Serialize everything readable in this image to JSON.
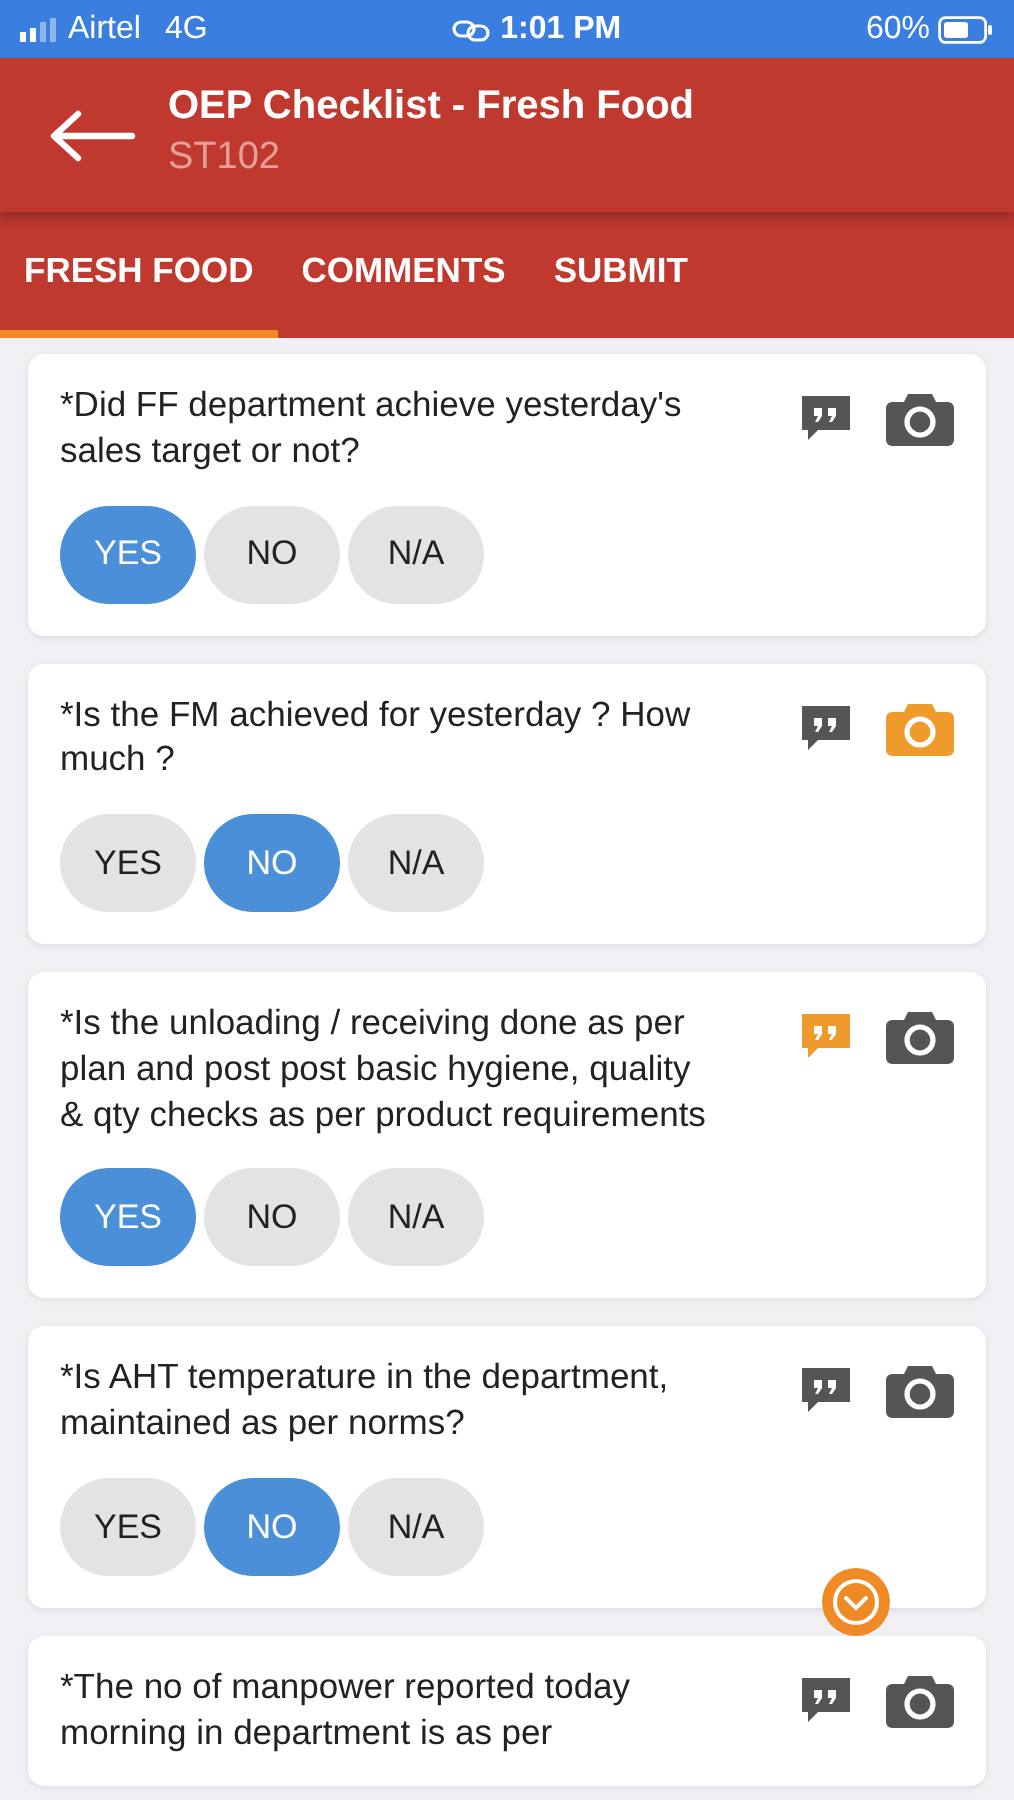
{
  "status_bar": {
    "carrier": "Airtel",
    "network": "4G",
    "time": "1:01 PM",
    "battery": "60%"
  },
  "header": {
    "title": "OEP Checklist - Fresh Food",
    "subtitle": "ST102"
  },
  "tabs": [
    {
      "label": "FRESH FOOD",
      "selected": true
    },
    {
      "label": "COMMENTS",
      "selected": false
    },
    {
      "label": "SUBMIT",
      "selected": false
    }
  ],
  "questions": [
    {
      "text": "*Did FF department achieve yesterday's sales target or not?",
      "comment_added": false,
      "photo_added": false,
      "options": [
        {
          "label": "YES",
          "selected": true
        },
        {
          "label": "NO",
          "selected": false
        },
        {
          "label": "N/A",
          "selected": false
        }
      ]
    },
    {
      "text": "*Is the FM achieved for yesterday ? How much ?",
      "comment_added": false,
      "photo_added": true,
      "options": [
        {
          "label": "YES",
          "selected": false
        },
        {
          "label": "NO",
          "selected": true
        },
        {
          "label": "N/A",
          "selected": false
        }
      ]
    },
    {
      "text": "*Is the unloading / receiving done as per plan and post post basic hygiene, quality & qty checks as per product requirements",
      "comment_added": true,
      "photo_added": false,
      "options": [
        {
          "label": "YES",
          "selected": true
        },
        {
          "label": "NO",
          "selected": false
        },
        {
          "label": "N/A",
          "selected": false
        }
      ]
    },
    {
      "text": "*Is AHT temperature in the department, maintained as per norms?",
      "comment_added": false,
      "photo_added": false,
      "scroll_button": true,
      "options": [
        {
          "label": "YES",
          "selected": false
        },
        {
          "label": "NO",
          "selected": true
        },
        {
          "label": "N/A",
          "selected": false
        }
      ]
    },
    {
      "text": "*The no of manpower reported today morning in department is as per",
      "comment_added": false,
      "photo_added": false
    }
  ]
}
